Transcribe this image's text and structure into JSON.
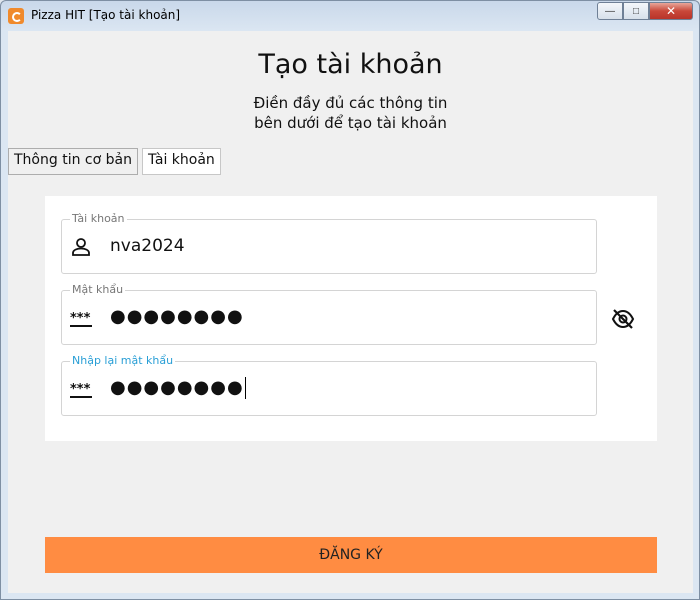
{
  "window": {
    "title": "Pizza HIT [Tạo tài khoản]",
    "minimize": "—",
    "maximize": "□",
    "close": "✕"
  },
  "header": {
    "title": "Tạo tài khoản",
    "subtitle_line1": "Điền đầy đủ các thông tin",
    "subtitle_line2": "bên dưới để tạo tài khoản"
  },
  "tabs": [
    {
      "label": "Thông tin cơ bản",
      "active": false
    },
    {
      "label": "Tài khoản",
      "active": true
    }
  ],
  "form": {
    "username": {
      "label": "Tài khoản",
      "value": "nva2024",
      "icon": "person-icon"
    },
    "password": {
      "label": "Mật khẩu",
      "value": "●●●●●●●●",
      "icon": "asterisk-icon"
    },
    "confirm_password": {
      "label": "Nhập lại mật khẩu",
      "value": "●●●●●●●●",
      "icon": "asterisk-icon"
    },
    "toggle_visibility_icon": "eye-off-icon"
  },
  "submit_label": "ĐĂNG KÝ",
  "colors": {
    "accent": "#ff8c42",
    "focus_label": "#2a9fd6"
  }
}
